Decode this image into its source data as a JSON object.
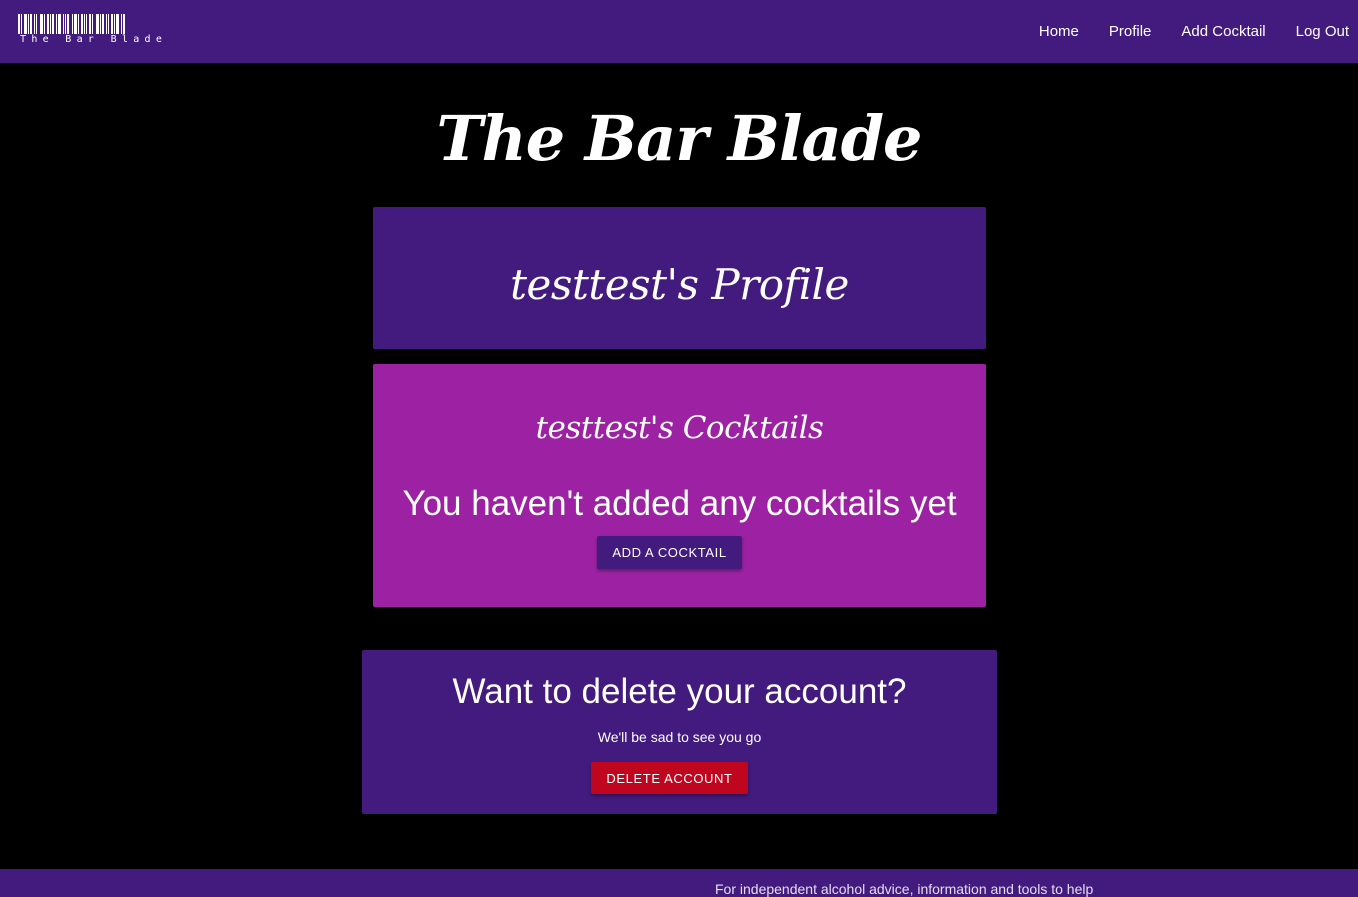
{
  "navbar": {
    "logo_text": "The Bar Blade",
    "links": [
      {
        "label": "Home"
      },
      {
        "label": "Profile"
      },
      {
        "label": "Add Cocktail"
      },
      {
        "label": "Log Out"
      }
    ]
  },
  "page": {
    "title": "The Bar Blade"
  },
  "profile": {
    "heading": "testtest's Profile"
  },
  "cocktails": {
    "heading": "testtest's Cocktails",
    "empty_message": "You haven't added any cocktails yet",
    "add_button_label": "ADD A COCKTAIL"
  },
  "delete_account": {
    "heading": "Want to delete your account?",
    "subtext": "We'll be sad to see you go",
    "button_label": "DELETE ACCOUNT"
  },
  "footer": {
    "text": "For independent alcohol advice, information and tools to help"
  },
  "colors": {
    "navbar": "#431b7f",
    "cocktail_card": "#9c22a3",
    "delete_button": "#c0061f",
    "background": "#000000"
  }
}
